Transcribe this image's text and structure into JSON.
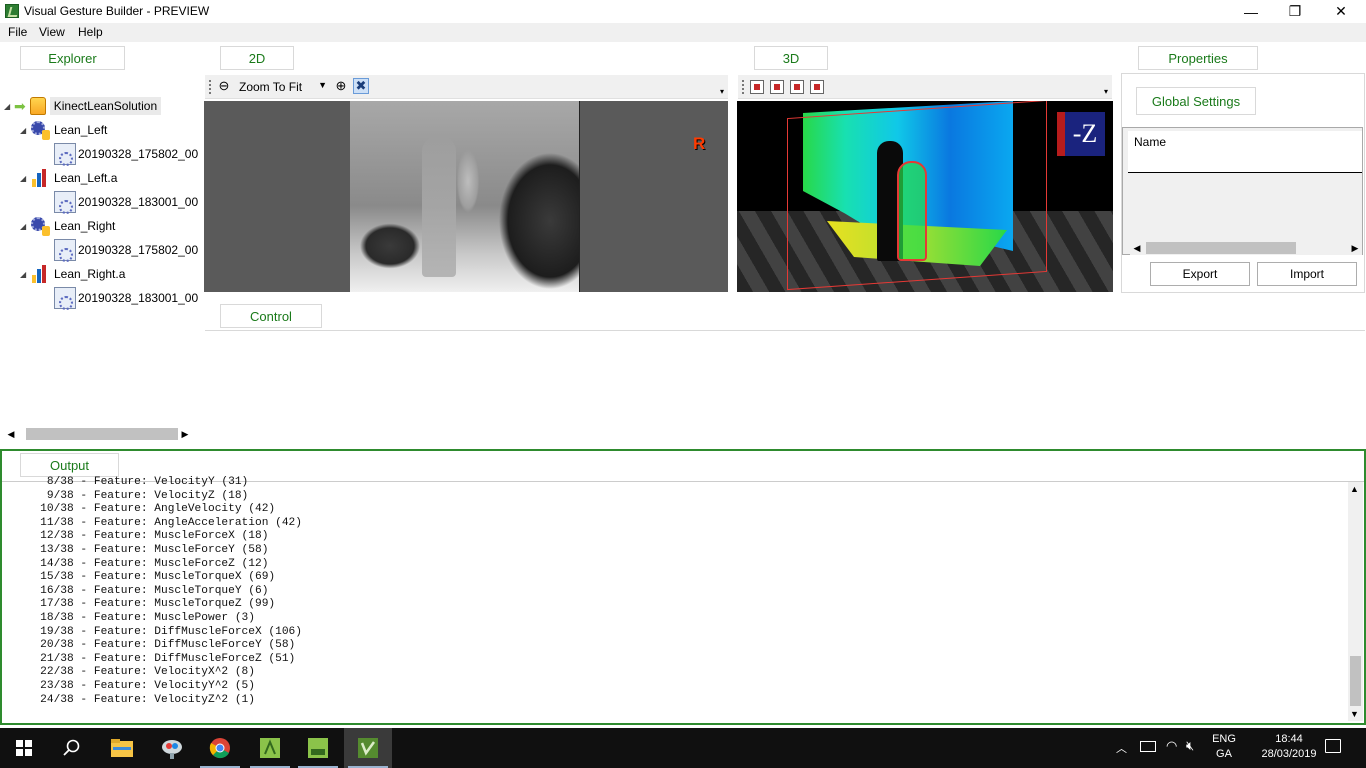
{
  "window": {
    "title": "Visual Gesture Builder - PREVIEW",
    "minimize": "—",
    "restore": "❐",
    "close": "✕"
  },
  "menu": [
    "File",
    "View",
    "Help"
  ],
  "panels": {
    "explorer": "Explorer",
    "view2d": "2D",
    "view3d": "3D",
    "properties": "Properties",
    "control": "Control",
    "output": "Output"
  },
  "explorer": {
    "solution": "KinectLeanSolution",
    "projects": [
      {
        "name": "Lean_Left",
        "icon": "gesture-project-icon",
        "clip": "20190328_175802_00"
      },
      {
        "name": "Lean_Left.a",
        "icon": "analysis-project-icon",
        "clip": "20190328_183001_00"
      },
      {
        "name": "Lean_Right",
        "icon": "gesture-project-icon",
        "clip": "20190328_175802_00"
      },
      {
        "name": "Lean_Right.a",
        "icon": "analysis-project-icon",
        "clip": "20190328_183001_00"
      }
    ]
  },
  "view2d": {
    "zoom_value": "Zoom To Fit",
    "overlay_label": "R",
    "zoom_out_icon": "⊖",
    "zoom_in_icon": "⊕",
    "fit_icon": "✖"
  },
  "view3d": {
    "axis_label": "-Z"
  },
  "properties": {
    "global_settings": "Global Settings",
    "grid_header": "Name",
    "export": "Export",
    "import": "Import"
  },
  "output": {
    "lines": [
      "    8/38 - Feature: VelocityY (31)",
      "    9/38 - Feature: VelocityZ (18)",
      "   10/38 - Feature: AngleVelocity (42)",
      "   11/38 - Feature: AngleAcceleration (42)",
      "   12/38 - Feature: MuscleForceX (18)",
      "   13/38 - Feature: MuscleForceY (58)",
      "   14/38 - Feature: MuscleForceZ (12)",
      "   15/38 - Feature: MuscleTorqueX (69)",
      "   16/38 - Feature: MuscleTorqueY (6)",
      "   17/38 - Feature: MuscleTorqueZ (99)",
      "   18/38 - Feature: MusclePower (3)",
      "   19/38 - Feature: DiffMuscleForceX (106)",
      "   20/38 - Feature: DiffMuscleForceY (58)",
      "   21/38 - Feature: DiffMuscleForceZ (51)",
      "   22/38 - Feature: VelocityX^2 (8)",
      "   23/38 - Feature: VelocityY^2 (5)",
      "   24/38 - Feature: VelocityZ^2 (1)"
    ]
  },
  "taskbar": {
    "apps": [
      "start-icon",
      "search-icon",
      "file-explorer-icon",
      "kinect-studio-icon",
      "chrome-icon",
      "gesture-tool-icon",
      "gesture-builder-icon",
      "visual-gesture-builder-icon"
    ],
    "language": "ENG",
    "layout": "GA",
    "time": "18:44",
    "date": "28/03/2019"
  },
  "colors": {
    "accent_green": "#1a7a1a",
    "output_border": "#2e8b2e",
    "taskbar": "#101010"
  }
}
